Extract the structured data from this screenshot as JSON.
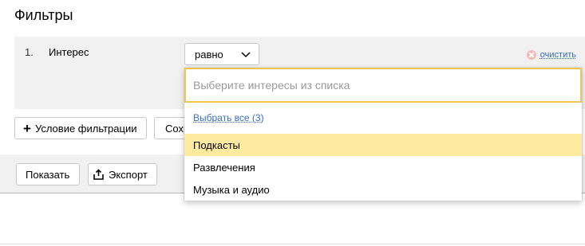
{
  "header": {
    "title": "Фильтры"
  },
  "filter": {
    "number": "1.",
    "name": "Интерес",
    "condition": "равно",
    "clear_label": "очистить",
    "add_condition_label": "Условие фильтрации",
    "save_label": "Сохр"
  },
  "actions": {
    "show_label": "Показать",
    "export_label": "Экспорт"
  },
  "dropdown": {
    "placeholder": "Выберите интересы из списка",
    "select_all": "Выбрать все  (3)",
    "options": [
      {
        "label": "Подкасты",
        "highlighted": true
      },
      {
        "label": "Развлечения",
        "highlighted": false
      },
      {
        "label": "Музыка и аудио",
        "highlighted": false
      }
    ]
  },
  "colors": {
    "accent": "#f0c550",
    "highlight": "#ffeba0",
    "link": "#3a6dc4",
    "panel": "#f1f1f1"
  }
}
